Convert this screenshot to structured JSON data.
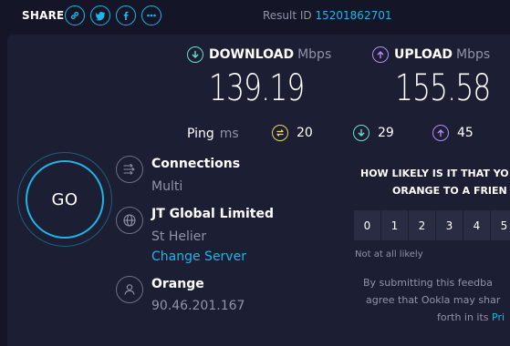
{
  "share": {
    "label": "SHARE",
    "icons": [
      "link-icon",
      "twitter-icon",
      "facebook-icon",
      "more-icon"
    ]
  },
  "result": {
    "label": "Result ID",
    "id": "15201862701"
  },
  "download": {
    "label": "DOWNLOAD",
    "unit": "Mbps",
    "value": "139.19",
    "color": "#6be0c8"
  },
  "upload": {
    "label": "UPLOAD",
    "unit": "Mbps",
    "value": "155.58",
    "color": "#b78bf0"
  },
  "ping": {
    "label": "Ping",
    "unit": "ms",
    "idle": {
      "value": "20",
      "color": "#e9d85a"
    },
    "download": {
      "value": "29",
      "color": "#6be0c8"
    },
    "upload": {
      "value": "45",
      "color": "#b78bf0"
    }
  },
  "go": {
    "label": "GO"
  },
  "connections": {
    "title": "Connections",
    "value": "Multi"
  },
  "server": {
    "name": "JT Global Limited",
    "location": "St Helier",
    "change_label": "Change Server"
  },
  "provider": {
    "name": "Orange",
    "ip": "90.46.201.167"
  },
  "survey": {
    "question_line1": "HOW LIKELY IS IT THAT YO",
    "question_line2": "ORANGE TO A FRIEN",
    "scale": [
      "0",
      "1",
      "2",
      "3",
      "4",
      "5"
    ],
    "min_label": "Not at all likely",
    "disclaimer_line1": "By submitting this feedba",
    "disclaimer_line2": "agree that Ookla may shar",
    "disclaimer_line3": "forth in its",
    "disclaimer_link": "Pri"
  },
  "colors": {
    "accent": "#1fb5e6",
    "background": "#141526",
    "panel": "#1c1e33"
  }
}
